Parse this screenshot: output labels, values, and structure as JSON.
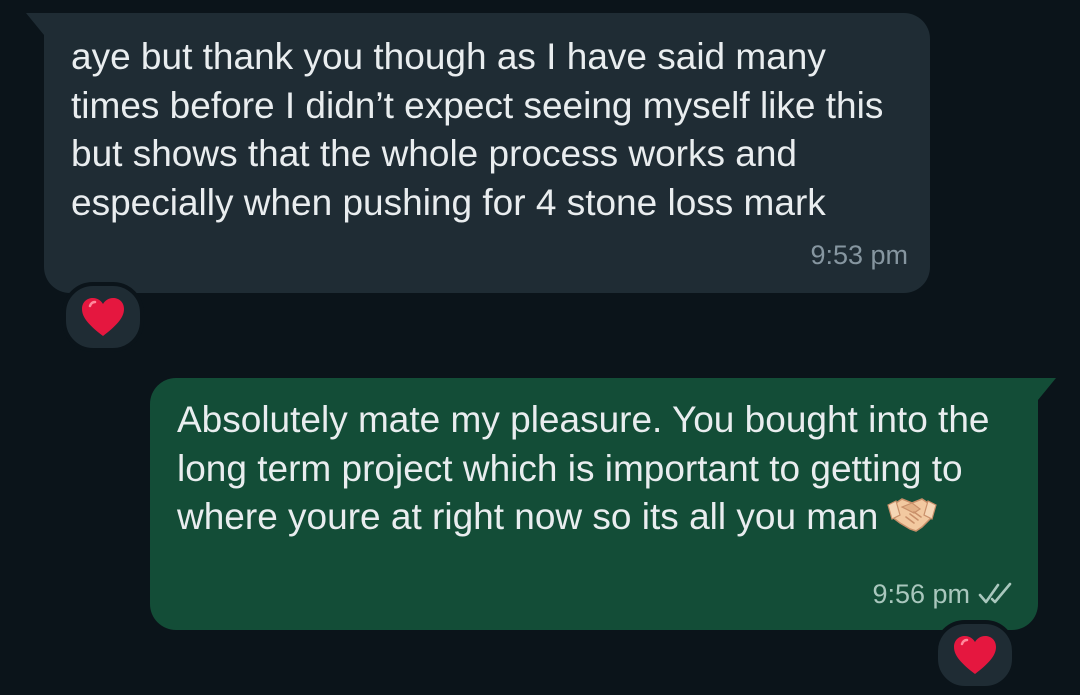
{
  "messages": {
    "incoming": {
      "text": "aye but thank you though as I have said many times before I didn’t expect seeing myself like this but shows that the whole process works and especially when pushing for 4 stone loss mark",
      "time": "9:53 pm",
      "reaction": "heart-icon"
    },
    "outgoing": {
      "text": "Absolutely mate my pleasure. You bought into the long term project which is important to getting to where youre at right now so its all you man",
      "emoji": "handshake-icon",
      "time": "9:56 pm",
      "status": "read-double-check-icon",
      "reaction": "heart-icon"
    }
  },
  "colors": {
    "background": "#0b141a",
    "incoming_bubble": "#1f2c34",
    "outgoing_bubble": "#134d37",
    "text": "#e9edef",
    "timestamp": "#8696a0",
    "heart": "#e5173f"
  }
}
